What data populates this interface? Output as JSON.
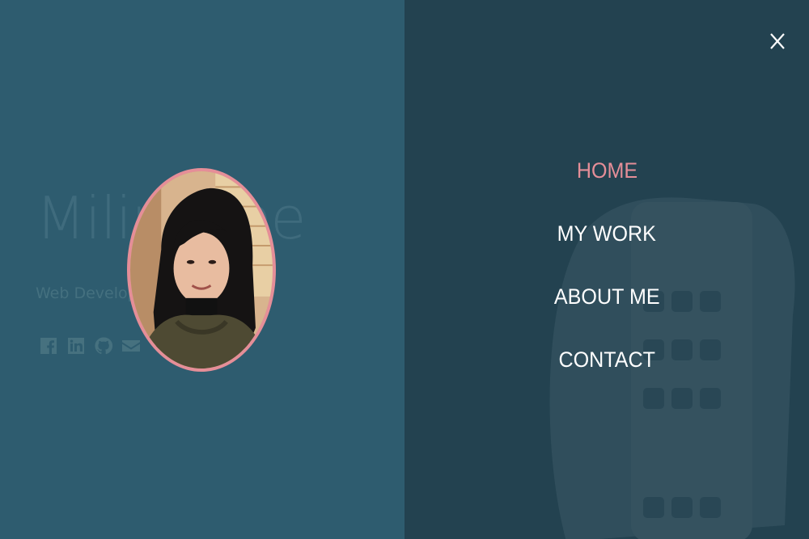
{
  "hero": {
    "name": "Milim Lee",
    "subtitle": "Web Developer, CA",
    "socials": [
      {
        "icon": "facebook-icon"
      },
      {
        "icon": "linkedin-icon"
      },
      {
        "icon": "github-icon"
      },
      {
        "icon": "email-icon"
      }
    ]
  },
  "menu": {
    "close_icon": "close-icon",
    "items": [
      {
        "label": "HOME",
        "active": true
      },
      {
        "label": "MY WORK",
        "active": false
      },
      {
        "label": "ABOUT ME",
        "active": false
      },
      {
        "label": "CONTACT",
        "active": false
      }
    ]
  },
  "colors": {
    "left_bg": "#2e5c6f",
    "menu_bg": "#234250",
    "accent": "#e58e98",
    "menu_text": "#ffffff"
  }
}
